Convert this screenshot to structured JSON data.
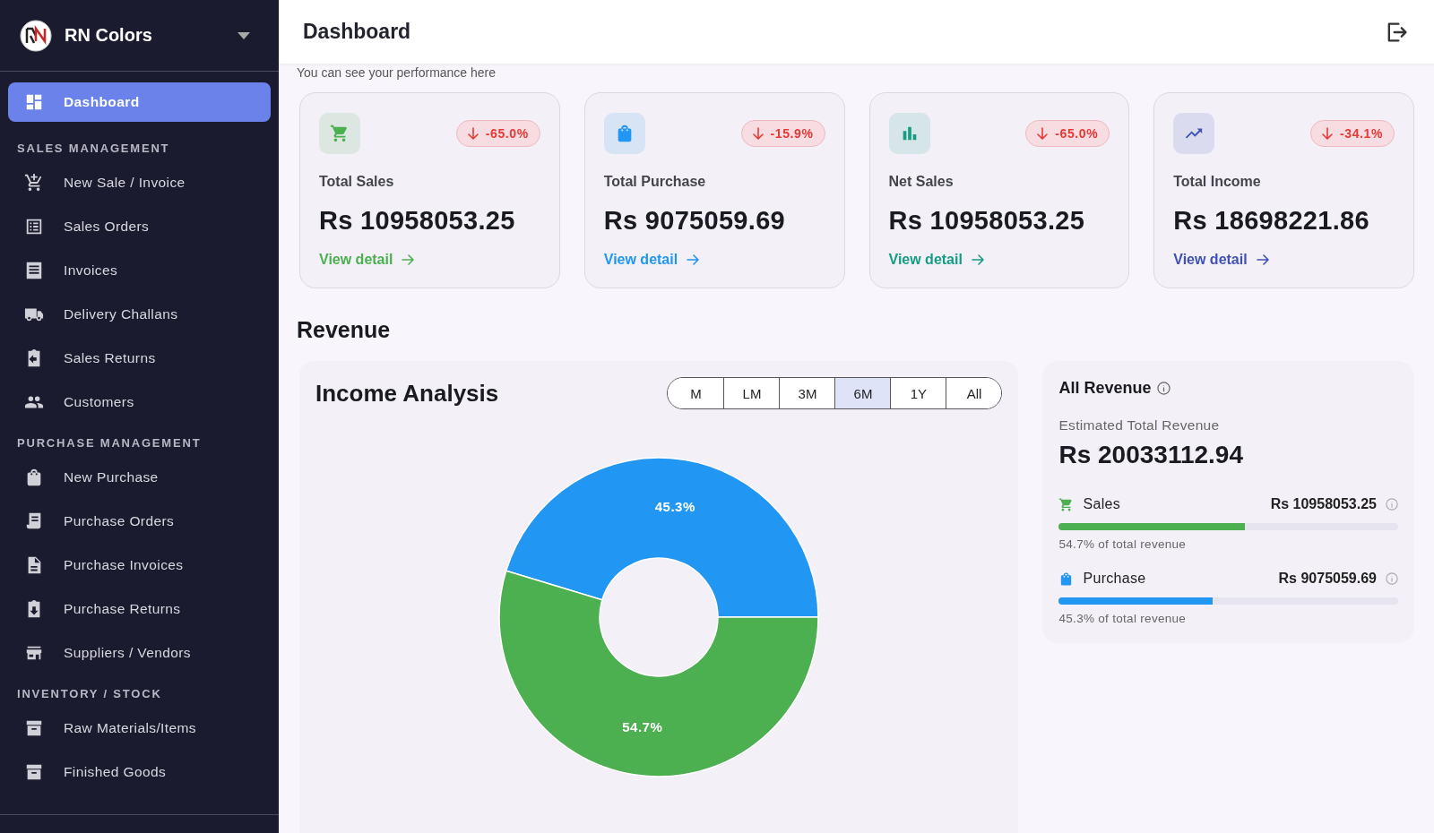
{
  "brand": {
    "name": "RN Colors"
  },
  "sidebar": {
    "items": [
      {
        "label": "Dashboard",
        "kind": "dashboard",
        "selected": true
      }
    ],
    "sections": [
      {
        "title": "SALES MANAGEMENT",
        "items": [
          {
            "label": "New Sale / Invoice",
            "kind": "cart-plus",
            "selected": false
          },
          {
            "label": "Sales Orders",
            "kind": "list",
            "selected": false
          },
          {
            "label": "Invoices",
            "kind": "receipt",
            "selected": false
          },
          {
            "label": "Delivery Challans",
            "kind": "truck",
            "selected": false
          },
          {
            "label": "Sales Returns",
            "kind": "return-in",
            "selected": false
          },
          {
            "label": "Customers",
            "kind": "people",
            "selected": false
          }
        ]
      },
      {
        "title": "PURCHASE MANAGEMENT",
        "items": [
          {
            "label": "New Purchase",
            "kind": "bag",
            "selected": false
          },
          {
            "label": "Purchase Orders",
            "kind": "scroll",
            "selected": false
          },
          {
            "label": "Purchase Invoices",
            "kind": "document",
            "selected": false
          },
          {
            "label": "Purchase Returns",
            "kind": "return-down",
            "selected": false
          },
          {
            "label": "Suppliers / Vendors",
            "kind": "store",
            "selected": false
          }
        ]
      },
      {
        "title": "INVENTORY / STOCK",
        "items": [
          {
            "label": "Raw Materials/Items",
            "kind": "archive",
            "selected": false
          },
          {
            "label": "Finished Goods",
            "kind": "archive",
            "selected": false
          }
        ]
      }
    ]
  },
  "header": {
    "title": "Dashboard"
  },
  "subtitle": "You can see your performance here",
  "cards": [
    {
      "kind": "cart",
      "color": "#4caf50",
      "change": "-65.0%",
      "label": "Total Sales",
      "value": "Rs 10958053.25",
      "link": "View detail"
    },
    {
      "kind": "bag",
      "color": "#2196f3",
      "change": "-15.9%",
      "label": "Total Purchase",
      "value": "Rs 9075059.69",
      "link": "View detail"
    },
    {
      "kind": "bars",
      "color": "#169c84",
      "change": "-65.0%",
      "label": "Net Sales",
      "value": "Rs 10958053.25",
      "link": "View detail"
    },
    {
      "kind": "trend",
      "color": "#3f51b5",
      "change": "-34.1%",
      "label": "Total Income",
      "value": "Rs 18698221.86",
      "link": "View detail"
    }
  ],
  "revenue_heading": "Revenue",
  "income_analysis": {
    "title": "Income Analysis",
    "periods": [
      {
        "label": "M",
        "selected": false
      },
      {
        "label": "LM",
        "selected": false
      },
      {
        "label": "3M",
        "selected": false
      },
      {
        "label": "6M",
        "selected": true
      },
      {
        "label": "1Y",
        "selected": false
      },
      {
        "label": "All",
        "selected": false
      }
    ],
    "chart_data": {
      "type": "donut",
      "values": [
        45.3,
        54.7
      ],
      "data_labels": true,
      "value_labels": [
        "45.3%",
        "54.7%"
      ]
    }
  },
  "all_revenue": {
    "title": "All Revenue",
    "subtitle": "Estimated Total Revenue",
    "total": "Rs 20033112.94",
    "items": [
      {
        "kind": "cart",
        "label": "Sales",
        "value": "Rs 10958053.25",
        "color": "#4caf50",
        "level": 0.547,
        "note": "54.7% of total revenue"
      },
      {
        "kind": "bag",
        "label": "Purchase",
        "value": "Rs 9075059.69",
        "color": "#2196f3",
        "level": 0.453,
        "note": "45.3% of total revenue"
      }
    ]
  }
}
